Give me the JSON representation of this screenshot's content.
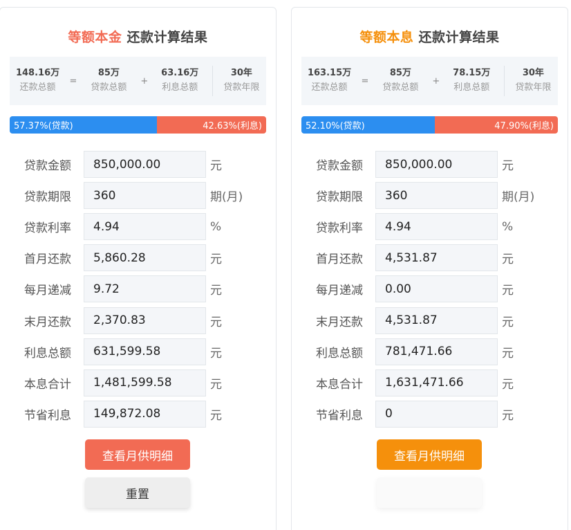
{
  "panels": [
    {
      "title_keyword": "等额本金",
      "title_rest": " 还款计算结果",
      "accent": "#f26b54",
      "summary": [
        {
          "value": "148.16万",
          "label": "还款总额"
        },
        {
          "value": "85万",
          "label": "贷款总额"
        },
        {
          "value": "63.16万",
          "label": "利息总额"
        },
        {
          "value": "30年",
          "label": "贷款年限"
        }
      ],
      "ops": [
        "=",
        "+"
      ],
      "ratio": {
        "loan_pct": 57.37,
        "loan_label": "57.37%(贷款)",
        "interest_label": "42.63%(利息)"
      },
      "rows": [
        {
          "label": "贷款金额",
          "value": "850,000.00",
          "unit": "元"
        },
        {
          "label": "贷款期限",
          "value": "360",
          "unit": "期(月)"
        },
        {
          "label": "贷款利率",
          "value": "4.94",
          "unit": "%"
        },
        {
          "label": "首月还款",
          "value": "5,860.28",
          "unit": "元"
        },
        {
          "label": "每月递减",
          "value": "9.72",
          "unit": "元"
        },
        {
          "label": "末月还款",
          "value": "2,370.83",
          "unit": "元"
        },
        {
          "label": "利息总额",
          "value": "631,599.58",
          "unit": "元"
        },
        {
          "label": "本息合计",
          "value": "1,481,599.58",
          "unit": "元"
        },
        {
          "label": "节省利息",
          "value": "149,872.08",
          "unit": "元"
        }
      ],
      "detail_button": "查看月供明细",
      "detail_color": "#f26b54",
      "reset_button": "重置"
    },
    {
      "title_keyword": "等额本息",
      "title_rest": " 还款计算结果",
      "accent": "#f5900c",
      "summary": [
        {
          "value": "163.15万",
          "label": "还款总额"
        },
        {
          "value": "85万",
          "label": "贷款总额"
        },
        {
          "value": "78.15万",
          "label": "利息总额"
        },
        {
          "value": "30年",
          "label": "贷款年限"
        }
      ],
      "ops": [
        "=",
        "+"
      ],
      "ratio": {
        "loan_pct": 52.1,
        "loan_label": "52.10%(贷款)",
        "interest_label": "47.90%(利息)"
      },
      "rows": [
        {
          "label": "贷款金额",
          "value": "850,000.00",
          "unit": "元"
        },
        {
          "label": "贷款期限",
          "value": "360",
          "unit": "期(月)"
        },
        {
          "label": "贷款利率",
          "value": "4.94",
          "unit": "%"
        },
        {
          "label": "首月还款",
          "value": "4,531.87",
          "unit": "元"
        },
        {
          "label": "每月递减",
          "value": "0.00",
          "unit": "元"
        },
        {
          "label": "末月还款",
          "value": "4,531.87",
          "unit": "元"
        },
        {
          "label": "利息总额",
          "value": "781,471.66",
          "unit": "元"
        },
        {
          "label": "本息合计",
          "value": "1,631,471.66",
          "unit": "元"
        },
        {
          "label": "节省利息",
          "value": "0",
          "unit": "元"
        }
      ],
      "detail_button": "查看月供明细",
      "detail_color": "#f5900c"
    }
  ]
}
